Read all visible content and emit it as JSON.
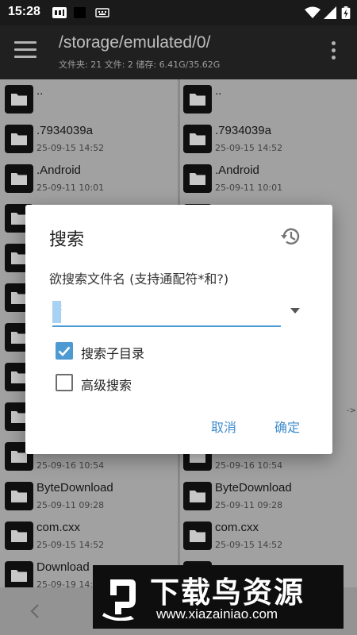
{
  "status_bar": {
    "time": "15:28"
  },
  "toolbar": {
    "title": "/storage/emulated/0/",
    "subtitle": "文件夹: 21  文件: 2  储存: 6.41G/35.62G"
  },
  "left_pane": {
    "rows": [
      {
        "name": "..",
        "date": ""
      },
      {
        "name": ".7934039a",
        "date": "25-09-15 14:52"
      },
      {
        "name": ".Android",
        "date": "25-09-11 10:01"
      },
      {
        "name": "",
        "date": ""
      },
      {
        "name": "",
        "date": ""
      },
      {
        "name": "",
        "date": ""
      },
      {
        "name": "",
        "date": ""
      },
      {
        "name": "",
        "date": ""
      },
      {
        "name": "",
        "date": ""
      },
      {
        "name": "",
        "date": "25-09-16 10:54"
      },
      {
        "name": "ByteDownload",
        "date": "25-09-11 09:28"
      },
      {
        "name": "com.cxx",
        "date": "25-09-15 14:52"
      },
      {
        "name": "Download",
        "date": "25-09-19 14:"
      }
    ]
  },
  "right_pane": {
    "rows": [
      {
        "name": "..",
        "date": ""
      },
      {
        "name": ".7934039a",
        "date": "25-09-15 14:52"
      },
      {
        "name": ".Android",
        "date": "25-09-11 10:01"
      },
      {
        "name": "",
        "date": ""
      },
      {
        "name": "",
        "date": ""
      },
      {
        "name": "",
        "date": ""
      },
      {
        "name": "",
        "date": ""
      },
      {
        "name": "",
        "date": ""
      },
      {
        "name": "",
        "date": ""
      },
      {
        "name": "",
        "date": "25-09-16 10:54"
      },
      {
        "name": "ByteDownload",
        "date": "25-09-11 09:28"
      },
      {
        "name": "com.cxx",
        "date": "25-09-15 14:52"
      },
      {
        "name": "",
        "date": ""
      }
    ],
    "arrow_hint": "->"
  },
  "dialog": {
    "title": "搜索",
    "label": "欲搜索文件名 (支持通配符*和?)",
    "input_value": "*",
    "search_subdirs": {
      "label": "搜索子目录",
      "checked": true
    },
    "advanced_search": {
      "label": "高级搜索",
      "checked": false
    },
    "cancel": "取消",
    "ok": "确定"
  },
  "watermark": {
    "title": "下载鸟资源",
    "url": "www.xiazainiao.com"
  },
  "colors": {
    "accent": "#4d9ad2",
    "button_text": "#3f8ccb",
    "toolbar": "#2a2a2a",
    "status_bar": "#1a1a1a"
  }
}
